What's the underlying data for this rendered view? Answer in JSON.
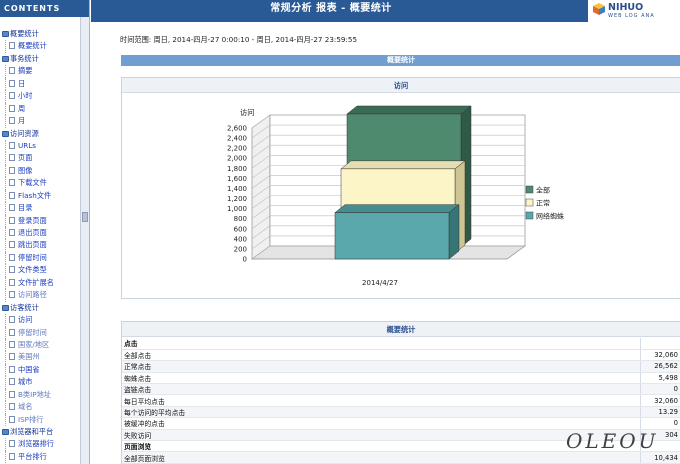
{
  "sidebar": {
    "header": "CONTENTS",
    "items": [
      {
        "label": "概要统计",
        "type": "group"
      },
      {
        "label": "概要统计",
        "type": "sub"
      },
      {
        "label": "事务统计",
        "type": "group"
      },
      {
        "label": "摘要",
        "type": "sub"
      },
      {
        "label": "日",
        "type": "sub"
      },
      {
        "label": "小时",
        "type": "sub"
      },
      {
        "label": "周",
        "type": "sub"
      },
      {
        "label": "月",
        "type": "sub"
      },
      {
        "label": "访问资源",
        "type": "group"
      },
      {
        "label": "URLs",
        "type": "sub"
      },
      {
        "label": "页面",
        "type": "sub"
      },
      {
        "label": "图像",
        "type": "sub"
      },
      {
        "label": "下载文件",
        "type": "sub"
      },
      {
        "label": "Flash文件",
        "type": "sub"
      },
      {
        "label": "目录",
        "type": "sub"
      },
      {
        "label": "登录页面",
        "type": "sub"
      },
      {
        "label": "退出页面",
        "type": "sub"
      },
      {
        "label": "跳出页面",
        "type": "sub"
      },
      {
        "label": "停留时间",
        "type": "sub"
      },
      {
        "label": "文件类型",
        "type": "sub"
      },
      {
        "label": "文件扩展名",
        "type": "sub"
      },
      {
        "label": "访问路径",
        "type": "sub-dim"
      },
      {
        "label": "访客统计",
        "type": "group"
      },
      {
        "label": "访问",
        "type": "sub"
      },
      {
        "label": "停留时间",
        "type": "sub-dim"
      },
      {
        "label": "国家/地区",
        "type": "sub-dim"
      },
      {
        "label": "美国州",
        "type": "sub-dim"
      },
      {
        "label": "中国省",
        "type": "sub"
      },
      {
        "label": "城市",
        "type": "sub"
      },
      {
        "label": "B类IP地址",
        "type": "sub-dim"
      },
      {
        "label": "域名",
        "type": "sub-dim"
      },
      {
        "label": "ISP排行",
        "type": "sub-dim"
      },
      {
        "label": "浏览器和平台",
        "type": "group"
      },
      {
        "label": "浏览器排行",
        "type": "sub"
      },
      {
        "label": "平台排行",
        "type": "sub"
      }
    ]
  },
  "header": {
    "title": "常规分析 报表 - 概要统计",
    "logo_brand": "NIHUO",
    "logo_tagline": "WEB LOG ANA"
  },
  "time_range": "时间范围: 周日, 2014-四月-27 0:00:10 - 周日, 2014-四月-27 23:59:55",
  "section_overview": "概要统计",
  "visits_panel": {
    "title": "访问"
  },
  "chart_data": {
    "type": "bar",
    "style": "3d-overlapping",
    "ylabel": "访问",
    "categories": [
      "2014/4/27"
    ],
    "ylim": [
      0,
      2600
    ],
    "yticks": [
      0,
      200,
      400,
      600,
      800,
      1000,
      1200,
      1400,
      1600,
      1800,
      2000,
      2200,
      2400,
      2600
    ],
    "ytick_labels": [
      "0",
      "200",
      "400",
      "600",
      "800",
      "1,000",
      "1,200",
      "1,400",
      "1,600",
      "1,800",
      "2,000",
      "2,200",
      "2,400",
      "2,600"
    ],
    "legend_position": "right",
    "series": [
      {
        "name": "全部",
        "values": [
          2640
        ],
        "color": "#4e8a6e",
        "top": "#3c6b55",
        "side": "#2f5a46"
      },
      {
        "name": "正常",
        "values": [
          1670
        ],
        "color": "#fbf5c8",
        "top": "#e6ddb0",
        "side": "#cfc593"
      },
      {
        "name": "网络蜘蛛",
        "values": [
          920
        ],
        "color": "#5aa8ab",
        "top": "#468d90",
        "side": "#377476"
      }
    ]
  },
  "stats_panel": {
    "title": "概要统计",
    "rows": [
      {
        "label": "点击",
        "value": "",
        "section": true
      },
      {
        "label": "全部点击",
        "value": "32,060"
      },
      {
        "label": "正常点击",
        "value": "26,562"
      },
      {
        "label": "蜘蛛点击",
        "value": "5,498"
      },
      {
        "label": "盗链点击",
        "value": "0"
      },
      {
        "label": "每日平均点击",
        "value": "32,060"
      },
      {
        "label": "每个访问的平均点击",
        "value": "13.29"
      },
      {
        "label": "被缓冲的点击",
        "value": "0"
      },
      {
        "label": "失败访问",
        "value": "304"
      },
      {
        "label": "页面浏览",
        "value": "",
        "section": true
      },
      {
        "label": "全部页面浏览",
        "value": "10,434"
      }
    ]
  },
  "watermark": "OLEOU"
}
